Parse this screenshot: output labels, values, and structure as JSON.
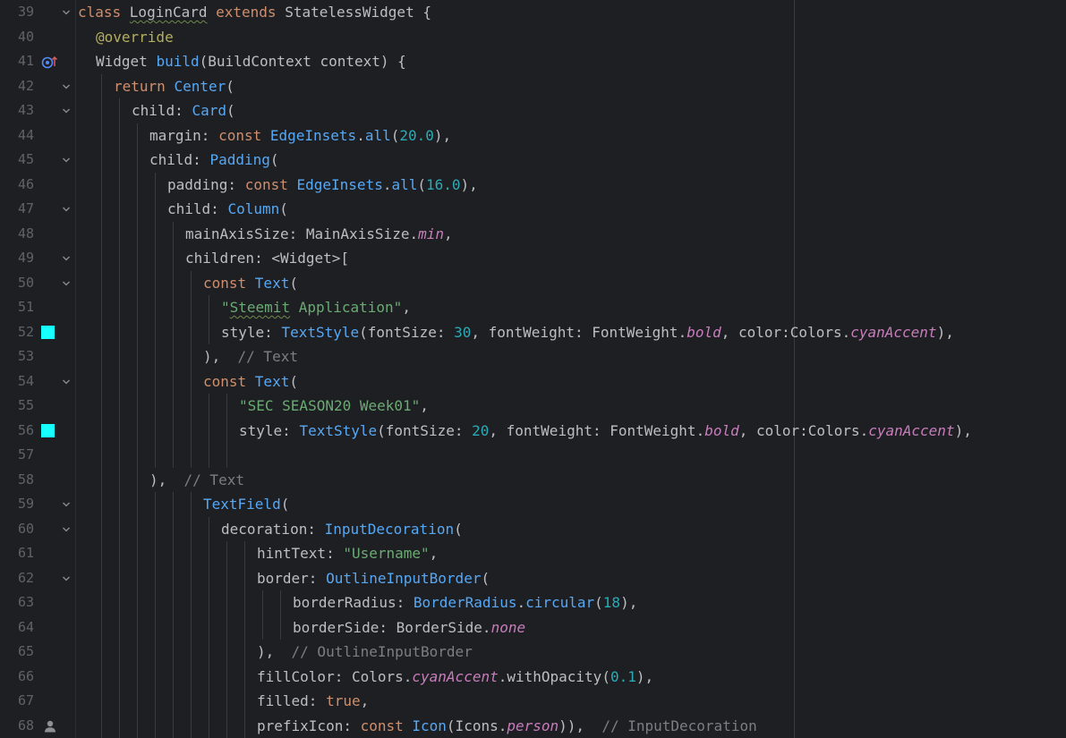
{
  "editor": {
    "background": "#1e1f22",
    "swatch_color": "#18ffff",
    "lines": [
      {
        "num": "39",
        "fold": true,
        "indent": 0,
        "tokens": [
          {
            "t": "class ",
            "c": "kw"
          },
          {
            "t": "LoginCard",
            "c": "plain typo"
          },
          {
            "t": " extends ",
            "c": "kw"
          },
          {
            "t": "StatelessWidget {",
            "c": "plain"
          }
        ]
      },
      {
        "num": "40",
        "indent": 1,
        "tokens": [
          {
            "t": "@override",
            "c": "ann"
          }
        ]
      },
      {
        "num": "41",
        "icon": "override-method-icon",
        "indent": 1,
        "tokens": [
          {
            "t": "Widget ",
            "c": "plain"
          },
          {
            "t": "build",
            "c": "fn"
          },
          {
            "t": "(BuildContext context) {",
            "c": "plain"
          }
        ]
      },
      {
        "num": "42",
        "fold": true,
        "indent": 2,
        "tokens": [
          {
            "t": "return ",
            "c": "kw"
          },
          {
            "t": "Center",
            "c": "fn"
          },
          {
            "t": "(",
            "c": "plain"
          }
        ]
      },
      {
        "num": "43",
        "fold": true,
        "indent": 3,
        "tokens": [
          {
            "t": "child: ",
            "c": "plain"
          },
          {
            "t": "Card",
            "c": "fn"
          },
          {
            "t": "(",
            "c": "plain"
          }
        ]
      },
      {
        "num": "44",
        "indent": 4,
        "tokens": [
          {
            "t": "margin: ",
            "c": "plain"
          },
          {
            "t": "const ",
            "c": "kw"
          },
          {
            "t": "EdgeInsets",
            "c": "fn"
          },
          {
            "t": ".",
            "c": "plain"
          },
          {
            "t": "all",
            "c": "fn"
          },
          {
            "t": "(",
            "c": "plain"
          },
          {
            "t": "20.0",
            "c": "num"
          },
          {
            "t": "),",
            "c": "plain"
          }
        ]
      },
      {
        "num": "45",
        "fold": true,
        "indent": 4,
        "tokens": [
          {
            "t": "child: ",
            "c": "plain"
          },
          {
            "t": "Padding",
            "c": "fn"
          },
          {
            "t": "(",
            "c": "plain"
          }
        ]
      },
      {
        "num": "46",
        "indent": 5,
        "tokens": [
          {
            "t": "padding: ",
            "c": "plain"
          },
          {
            "t": "const ",
            "c": "kw"
          },
          {
            "t": "EdgeInsets",
            "c": "fn"
          },
          {
            "t": ".",
            "c": "plain"
          },
          {
            "t": "all",
            "c": "fn"
          },
          {
            "t": "(",
            "c": "plain"
          },
          {
            "t": "16.0",
            "c": "num"
          },
          {
            "t": "),",
            "c": "plain"
          }
        ]
      },
      {
        "num": "47",
        "fold": true,
        "indent": 5,
        "tokens": [
          {
            "t": "child: ",
            "c": "plain"
          },
          {
            "t": "Column",
            "c": "fn"
          },
          {
            "t": "(",
            "c": "plain"
          }
        ]
      },
      {
        "num": "48",
        "indent": 6,
        "tokens": [
          {
            "t": "mainAxisSize: MainAxisSize.",
            "c": "plain"
          },
          {
            "t": "min",
            "c": "en"
          },
          {
            "t": ",",
            "c": "plain"
          }
        ]
      },
      {
        "num": "49",
        "fold": true,
        "indent": 6,
        "tokens": [
          {
            "t": "children: <Widget>[",
            "c": "plain"
          }
        ]
      },
      {
        "num": "50",
        "fold": true,
        "indent": 7,
        "tokens": [
          {
            "t": "const ",
            "c": "kw"
          },
          {
            "t": "Text",
            "c": "fn"
          },
          {
            "t": "(",
            "c": "plain"
          }
        ]
      },
      {
        "num": "51",
        "indent": 8,
        "tokens": [
          {
            "t": "\"",
            "c": "str"
          },
          {
            "t": "Steemit",
            "c": "str typo"
          },
          {
            "t": " Application\"",
            "c": "str"
          },
          {
            "t": ",",
            "c": "plain"
          }
        ]
      },
      {
        "num": "52",
        "swatch": true,
        "indent": 8,
        "tokens": [
          {
            "t": "style: ",
            "c": "plain"
          },
          {
            "t": "TextStyle",
            "c": "fn"
          },
          {
            "t": "(fontSize: ",
            "c": "plain"
          },
          {
            "t": "30",
            "c": "num"
          },
          {
            "t": ", fontWeight: FontWeight.",
            "c": "plain"
          },
          {
            "t": "bold",
            "c": "en"
          },
          {
            "t": ", color:Colors.",
            "c": "plain"
          },
          {
            "t": "cyanAccent",
            "c": "en"
          },
          {
            "t": "),",
            "c": "plain"
          }
        ]
      },
      {
        "num": "53",
        "indent": 7,
        "tokens": [
          {
            "t": "),  ",
            "c": "plain"
          },
          {
            "t": "// Text",
            "c": "cm"
          }
        ]
      },
      {
        "num": "54",
        "fold": true,
        "indent": 7,
        "tokens": [
          {
            "t": "const ",
            "c": "kw"
          },
          {
            "t": "Text",
            "c": "fn"
          },
          {
            "t": "(",
            "c": "plain"
          }
        ]
      },
      {
        "num": "55",
        "indent": 9,
        "tokens": [
          {
            "t": "\"SEC SEASON20 Week01\"",
            "c": "str"
          },
          {
            "t": ",",
            "c": "plain"
          }
        ]
      },
      {
        "num": "56",
        "swatch": true,
        "indent": 9,
        "tokens": [
          {
            "t": "style: ",
            "c": "plain"
          },
          {
            "t": "TextStyle",
            "c": "fn"
          },
          {
            "t": "(fontSize: ",
            "c": "plain"
          },
          {
            "t": "20",
            "c": "num"
          },
          {
            "t": ", fontWeight: FontWeight.",
            "c": "plain"
          },
          {
            "t": "bold",
            "c": "en"
          },
          {
            "t": ", color:Colors.",
            "c": "plain"
          },
          {
            "t": "cyanAccent",
            "c": "en"
          },
          {
            "t": "),",
            "c": "plain"
          }
        ]
      },
      {
        "num": "57",
        "indent": 0,
        "tokens": []
      },
      {
        "num": "58",
        "indent": 4,
        "tokens": [
          {
            "t": "),  ",
            "c": "plain"
          },
          {
            "t": "// Text",
            "c": "cm"
          }
        ]
      },
      {
        "num": "59",
        "fold": true,
        "indent": 7,
        "tokens": [
          {
            "t": "TextField",
            "c": "fn"
          },
          {
            "t": "(",
            "c": "plain"
          }
        ]
      },
      {
        "num": "60",
        "fold": true,
        "indent": 8,
        "tokens": [
          {
            "t": "decoration: ",
            "c": "plain"
          },
          {
            "t": "InputDecoration",
            "c": "fn"
          },
          {
            "t": "(",
            "c": "plain"
          }
        ]
      },
      {
        "num": "61",
        "indent": 10,
        "tokens": [
          {
            "t": "hintText: ",
            "c": "plain"
          },
          {
            "t": "\"Username\"",
            "c": "str"
          },
          {
            "t": ",",
            "c": "plain"
          }
        ]
      },
      {
        "num": "62",
        "fold": true,
        "indent": 10,
        "tokens": [
          {
            "t": "border: ",
            "c": "plain"
          },
          {
            "t": "OutlineInputBorder",
            "c": "fn"
          },
          {
            "t": "(",
            "c": "plain"
          }
        ]
      },
      {
        "num": "63",
        "indent": 12,
        "tokens": [
          {
            "t": "borderRadius: ",
            "c": "plain"
          },
          {
            "t": "BorderRadius",
            "c": "fn"
          },
          {
            "t": ".",
            "c": "plain"
          },
          {
            "t": "circular",
            "c": "fn"
          },
          {
            "t": "(",
            "c": "plain"
          },
          {
            "t": "18",
            "c": "num"
          },
          {
            "t": "),",
            "c": "plain"
          }
        ]
      },
      {
        "num": "64",
        "indent": 12,
        "tokens": [
          {
            "t": "borderSide: BorderSide.",
            "c": "plain"
          },
          {
            "t": "none",
            "c": "en"
          }
        ]
      },
      {
        "num": "65",
        "indent": 10,
        "tokens": [
          {
            "t": "),  ",
            "c": "plain"
          },
          {
            "t": "// OutlineInputBorder",
            "c": "cm"
          }
        ]
      },
      {
        "num": "66",
        "indent": 10,
        "tokens": [
          {
            "t": "fillColor: Colors.",
            "c": "plain"
          },
          {
            "t": "cyanAccent",
            "c": "en"
          },
          {
            "t": ".withOpacity(",
            "c": "plain"
          },
          {
            "t": "0.1",
            "c": "num"
          },
          {
            "t": "),",
            "c": "plain"
          }
        ]
      },
      {
        "num": "67",
        "indent": 10,
        "tokens": [
          {
            "t": "filled: ",
            "c": "plain"
          },
          {
            "t": "true",
            "c": "kw"
          },
          {
            "t": ",",
            "c": "plain"
          }
        ]
      },
      {
        "num": "68",
        "icon": "person-icon",
        "indent": 10,
        "tokens": [
          {
            "t": "prefixIcon: ",
            "c": "plain"
          },
          {
            "t": "const ",
            "c": "kw"
          },
          {
            "t": "Icon",
            "c": "fn"
          },
          {
            "t": "(Icons.",
            "c": "plain"
          },
          {
            "t": "person",
            "c": "en"
          },
          {
            "t": ")),  ",
            "c": "plain"
          },
          {
            "t": "// InputDecoration",
            "c": "cm"
          }
        ]
      }
    ]
  }
}
